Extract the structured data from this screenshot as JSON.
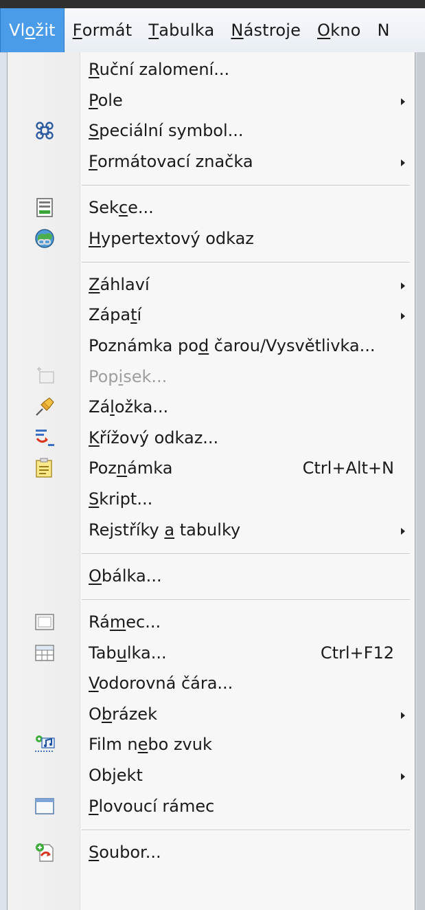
{
  "menubar": {
    "items": [
      {
        "pre": "Vl",
        "u": "o",
        "post": "žit",
        "active": true
      },
      {
        "pre": "",
        "u": "F",
        "post": "ormát",
        "active": false
      },
      {
        "pre": "",
        "u": "T",
        "post": "abulka",
        "active": false
      },
      {
        "pre": "",
        "u": "N",
        "post": "ástroje",
        "active": false
      },
      {
        "pre": "",
        "u": "O",
        "post": "kno",
        "active": false
      },
      {
        "pre": "N",
        "u": "",
        "post": "",
        "active": false
      }
    ]
  },
  "menu": {
    "items": [
      {
        "pre": "",
        "u": "R",
        "post": "uční zalomení...",
        "icon": "",
        "shortcut": "",
        "submenu": false,
        "disabled": false
      },
      {
        "pre": "",
        "u": "P",
        "post": "ole",
        "icon": "",
        "shortcut": "",
        "submenu": true,
        "disabled": false
      },
      {
        "pre": "",
        "u": "S",
        "post": "peciální symbol...",
        "icon": "special-symbol",
        "shortcut": "",
        "submenu": false,
        "disabled": false
      },
      {
        "pre": "",
        "u": "F",
        "post": "ormátovací značka",
        "icon": "",
        "shortcut": "",
        "submenu": true,
        "disabled": false
      },
      {
        "separator": true
      },
      {
        "pre": "Sek",
        "u": "c",
        "post": "e...",
        "icon": "section",
        "shortcut": "",
        "submenu": false,
        "disabled": false
      },
      {
        "pre": "",
        "u": "H",
        "post": "ypertextový odkaz",
        "icon": "hyperlink",
        "shortcut": "",
        "submenu": false,
        "disabled": false
      },
      {
        "separator": true
      },
      {
        "pre": "",
        "u": "Z",
        "post": "áhlaví",
        "icon": "",
        "shortcut": "",
        "submenu": true,
        "disabled": false
      },
      {
        "pre": "Zápa",
        "u": "t",
        "post": "í",
        "icon": "",
        "shortcut": "",
        "submenu": true,
        "disabled": false
      },
      {
        "pre": "Poznámka po",
        "u": "d",
        "post": " čarou/Vysvětlivka...",
        "icon": "",
        "shortcut": "",
        "submenu": false,
        "disabled": false
      },
      {
        "pre": "Pop",
        "u": "i",
        "post": "sek...",
        "icon": "caption",
        "shortcut": "",
        "submenu": false,
        "disabled": true
      },
      {
        "pre": "Zá",
        "u": "l",
        "post": "ožka...",
        "icon": "bookmark",
        "shortcut": "",
        "submenu": false,
        "disabled": false
      },
      {
        "pre": "",
        "u": "K",
        "post": "řížový odkaz...",
        "icon": "cross-reference",
        "shortcut": "",
        "submenu": false,
        "disabled": false
      },
      {
        "pre": "Poz",
        "u": "n",
        "post": "ámka",
        "icon": "comment",
        "shortcut": "Ctrl+Alt+N",
        "submenu": false,
        "disabled": false
      },
      {
        "pre": "",
        "u": "S",
        "post": "kript...",
        "icon": "",
        "shortcut": "",
        "submenu": false,
        "disabled": false
      },
      {
        "pre": "Rejstříky ",
        "u": "a",
        "post": " tabulky",
        "icon": "",
        "shortcut": "",
        "submenu": true,
        "disabled": false
      },
      {
        "separator": true
      },
      {
        "pre": "",
        "u": "O",
        "post": "bálka...",
        "icon": "",
        "shortcut": "",
        "submenu": false,
        "disabled": false
      },
      {
        "separator": true
      },
      {
        "pre": "Rá",
        "u": "m",
        "post": "ec...",
        "icon": "frame",
        "shortcut": "",
        "submenu": false,
        "disabled": false
      },
      {
        "pre": "Tab",
        "u": "u",
        "post": "lka...",
        "icon": "table",
        "shortcut": "Ctrl+F12",
        "submenu": false,
        "disabled": false
      },
      {
        "pre": "",
        "u": "V",
        "post": "odorovná čára...",
        "icon": "",
        "shortcut": "",
        "submenu": false,
        "disabled": false
      },
      {
        "pre": "O",
        "u": "b",
        "post": "rázek",
        "icon": "",
        "shortcut": "",
        "submenu": true,
        "disabled": false
      },
      {
        "pre": "Film n",
        "u": "e",
        "post": "bo zvuk",
        "icon": "movie-sound",
        "shortcut": "",
        "submenu": false,
        "disabled": false
      },
      {
        "pre": "Objekt",
        "u": "",
        "post": "",
        "icon": "",
        "shortcut": "",
        "submenu": true,
        "disabled": false
      },
      {
        "pre": "",
        "u": "P",
        "post": "lovoucí rámec",
        "icon": "floating-frame",
        "shortcut": "",
        "submenu": false,
        "disabled": false
      },
      {
        "separator": true
      },
      {
        "pre": "",
        "u": "S",
        "post": "oubor...",
        "icon": "file",
        "shortcut": "",
        "submenu": false,
        "disabled": false
      }
    ]
  }
}
